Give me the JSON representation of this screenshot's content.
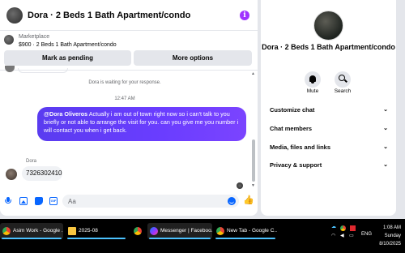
{
  "header": {
    "title": "Dora · 2 Beds 1 Bath Apartment/condo",
    "info_icon": "info-icon"
  },
  "marketplace": {
    "label": "Marketplace",
    "listing": "$900 · 2 Beds 1 Bath Apartment/condo"
  },
  "actions": {
    "pending_label": "Mark as pending",
    "more_label": "More options"
  },
  "conversation": {
    "waiting_text": "Dora is waiting for your response.",
    "timestamp": "12:47 AM",
    "outgoing": {
      "mention": "@Dora Oliveros",
      "text": " Actually i am out of town right now so i can't talk to you briefly or not able to arrange the visit for you. can you give me you number i will contact you when i get back."
    },
    "incoming": {
      "sender": "Dora",
      "text": "7326302410"
    }
  },
  "composer": {
    "placeholder": "Aa",
    "icons": [
      "microphone-icon",
      "photo-icon",
      "sticker-icon",
      "gif-icon",
      "emoji-icon",
      "like-icon"
    ],
    "gif_text": "GIF"
  },
  "info_panel": {
    "title": "Dora · 2 Beds 1 Bath Apartment/condo",
    "mute_label": "Mute",
    "search_label": "Search",
    "sections": [
      "Customize chat",
      "Chat members",
      "Media, files and links",
      "Privacy & support"
    ]
  },
  "taskbar": {
    "tasks": [
      {
        "label": "Asim Work - Google ...",
        "icon": "chrome-icon"
      },
      {
        "label": "2025-08",
        "icon": "folder-icon"
      },
      {
        "label": "Messenger | Faceboo...",
        "icon": "messenger-icon"
      },
      {
        "label": "New Tab - Google C...",
        "icon": "chrome-icon"
      }
    ],
    "language": "ENG",
    "time": "1:08 AM",
    "day": "Sunday",
    "date": "8/10/2025"
  },
  "colors": {
    "accent": "#0866ff",
    "bubble": "#6a3dff",
    "taskbar": "#000000"
  }
}
